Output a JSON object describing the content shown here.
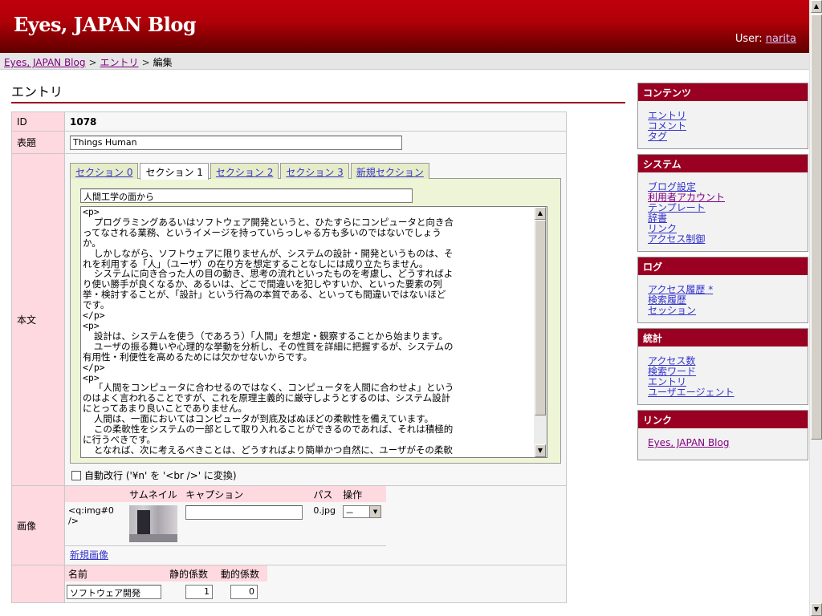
{
  "header": {
    "title": "Eyes, JAPAN Blog",
    "user_label": "User:",
    "user_name": "narita"
  },
  "breadcrumb": {
    "home": "Eyes, JAPAN Blog",
    "section": "エントリ",
    "current": "編集",
    "separator": ">"
  },
  "page": {
    "heading": "エントリ"
  },
  "form": {
    "id_label": "ID",
    "id_value": "1078",
    "title_label": "表題",
    "title_value": "Things Human",
    "body_label": "本文",
    "tabs": [
      "セクション 0",
      "セクション 1",
      "セクション 2",
      "セクション 3",
      "新規セクション"
    ],
    "active_tab": 1,
    "section_title": "人間工学の面から",
    "section_body": "<p>\n  プログラミングあるいはソフトウェア開発というと、ひたすらにコンピュータと向き合\nってなされる業務、というイメージを持っていらっしゃる方も多いのではないでしょう\nか。\n  しかしながら、ソフトウェアに限りませんが、システムの設計・開発というものは、そ\nれを利用する「人」（ユーザ）の在り方を想定することなしには成り立たちません。\n  システムに向き合った人の目の動き、思考の流れといったものを考慮し、どうすればよ\nり使い勝手が良くなるか、あるいは、どこで間違いを犯しやすいか、といった要素の列\n挙・検討することが、「設計」という行為の本質である、といっても間違いではないほど\nです。\n</p>\n<p>\n  設計は、システムを使う（であろう）「人間」を想定・観察することから始まります。\n  ユーザの振る舞いや心理的な挙動を分析し、その性質を詳細に把握するが、システムの\n有用性・利便性を高めるためには欠かせないからです。\n</p>\n<p>\n  「人間をコンピュータに合わせるのではなく、コンピュータを人間に合わせよ」という\nのはよく言われることですが、これを原理主義的に厳守しようとするのは、システム設計\nにとってあまり良いことでありません。\n  人間は、一面においてはコンピュータが到底及ばぬほどの柔軟性を備えています。\n  この柔軟性をシステムの一部として取り入れることができるのであれば、それは積極的\nに行うべきです。\n  となれば、次に考えるべきことは、どうすればより簡単かつ自然に、ユーザがその柔軟",
    "autobreak_label": "自動改行 ('¥n' を '<br />' に変換)",
    "image_label": "画像",
    "image_headers": [
      "サムネイル",
      "キャプション",
      "パス",
      "操作"
    ],
    "image_row": {
      "tag": "<q:img#0 />",
      "caption": "",
      "path": "0.jpg",
      "op": "－"
    },
    "new_image": "新規画像",
    "tag_headers": [
      "名前",
      "静的係数",
      "動的係数"
    ],
    "tag_row": {
      "name": "ソフトウェア開発",
      "static": "1",
      "dynamic": "0"
    }
  },
  "sidebar": [
    {
      "title": "コンテンツ",
      "items": [
        "エントリ",
        "コメント",
        "タグ"
      ]
    },
    {
      "title": "システム",
      "items": [
        "ブログ設定",
        "利用者アカウント",
        "テンプレート",
        "辞書",
        "リンク",
        "アクセス制御"
      ]
    },
    {
      "title": "ログ",
      "items": [
        "アクセス履歴 *",
        "検索履歴",
        "セッション"
      ]
    },
    {
      "title": "統計",
      "items": [
        "アクセス数",
        "検索ワード",
        "エントリ",
        "ユーザエージェント"
      ]
    },
    {
      "title": "リンク",
      "items": [
        "Eyes, JAPAN Blog"
      ]
    }
  ],
  "icons": {
    "scroll_up": "up-arrow-icon",
    "scroll_down": "down-arrow-icon"
  }
}
